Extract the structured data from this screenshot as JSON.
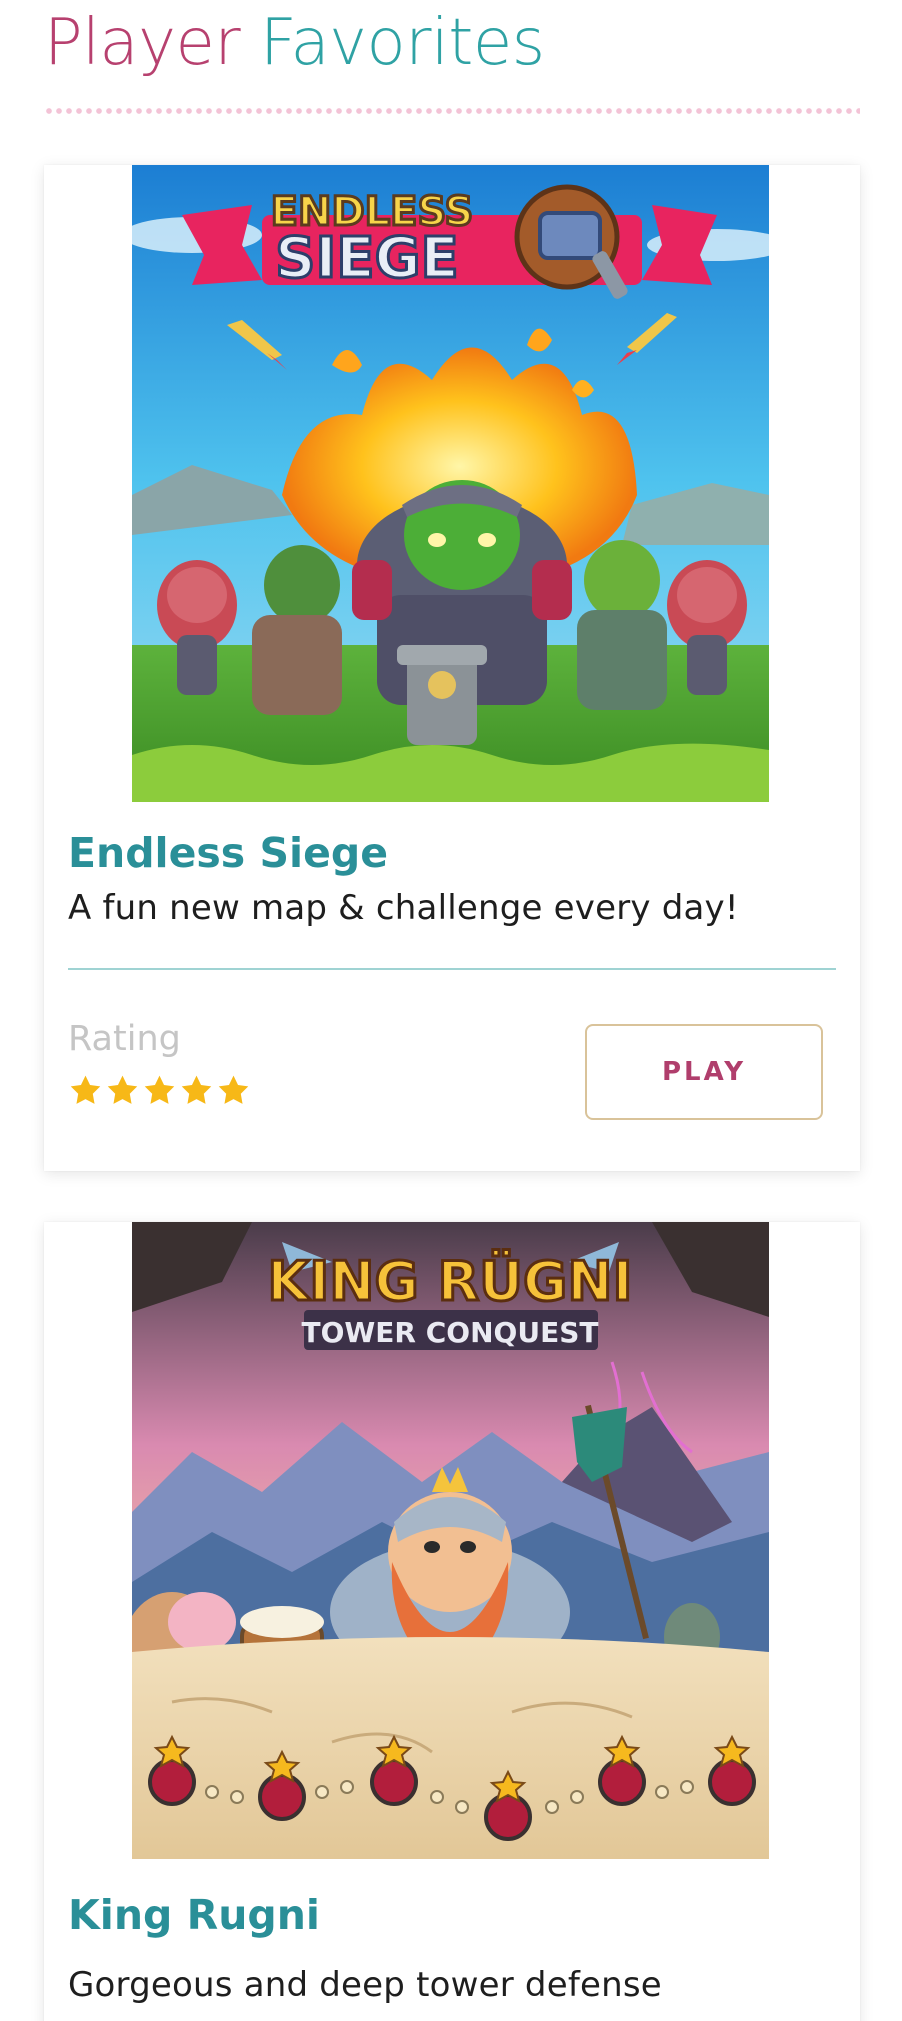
{
  "header": {
    "title_part1": "Player",
    "title_part2": "Favorites"
  },
  "colors": {
    "title_pink": "#b7416f",
    "title_teal": "#2fa2a4",
    "game_title": "#2a8f98",
    "star": "#f7b817",
    "play_text": "#b03e6c",
    "play_border": "#d9c39a"
  },
  "games": [
    {
      "title": "Endless Siege",
      "description": "A fun new map & challenge every day!",
      "rating_label": "Rating",
      "rating": 5,
      "rating_max": 5,
      "play_label": "PLAY",
      "logo_line1": "ENDLESS",
      "logo_line2": "SIEGE"
    },
    {
      "title": "King Rugni",
      "description": "Gorgeous and deep tower defense",
      "logo_line1": "KING RÜGNI",
      "logo_line2": "TOWER CONQUEST"
    }
  ]
}
